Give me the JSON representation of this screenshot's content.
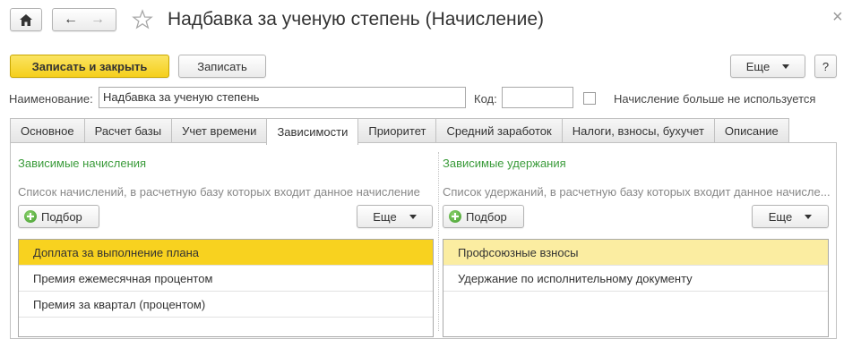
{
  "window": {
    "title": "Надбавка за ученую степень (Начисление)",
    "close_glyph": "×"
  },
  "toolbar": {
    "save_close_label": "Записать и закрыть",
    "save_label": "Записать",
    "more_label": "Еще",
    "help_label": "?"
  },
  "form": {
    "name_label": "Наименование:",
    "name_value": "Надбавка за ученую степень",
    "code_label": "Код:",
    "code_value": "",
    "unused_label": "Начисление больше не используется",
    "unused_checked": false
  },
  "tabs": [
    {
      "label": "Основное"
    },
    {
      "label": "Расчет базы"
    },
    {
      "label": "Учет времени"
    },
    {
      "label": "Зависимости",
      "active": true
    },
    {
      "label": "Приоритет"
    },
    {
      "label": "Средний заработок"
    },
    {
      "label": "Налоги, взносы, бухучет"
    },
    {
      "label": "Описание"
    }
  ],
  "dependencies": {
    "accruals": {
      "title": "Зависимые начисления",
      "hint": "Список начислений, в расчетную базу которых входит данное начисление",
      "pick_label": "Подбор",
      "more_label": "Еще",
      "items": [
        {
          "label": "Доплата за выполнение плана"
        },
        {
          "label": "Премия ежемесячная процентом"
        },
        {
          "label": "Премия за квартал (процентом)"
        }
      ]
    },
    "deductions": {
      "title": "Зависимые удержания",
      "hint": "Список удержаний, в расчетную базу которых входит данное начисле...",
      "pick_label": "Подбор",
      "more_label": "Еще",
      "items": [
        {
          "label": "Профсоюзные взносы"
        },
        {
          "label": "Удержание по исполнительному документу"
        }
      ]
    }
  },
  "colors": {
    "accent_yellow": "#f5cf1c",
    "section_green": "#3a9b3a",
    "selection_yellow": "#f8d21f"
  }
}
